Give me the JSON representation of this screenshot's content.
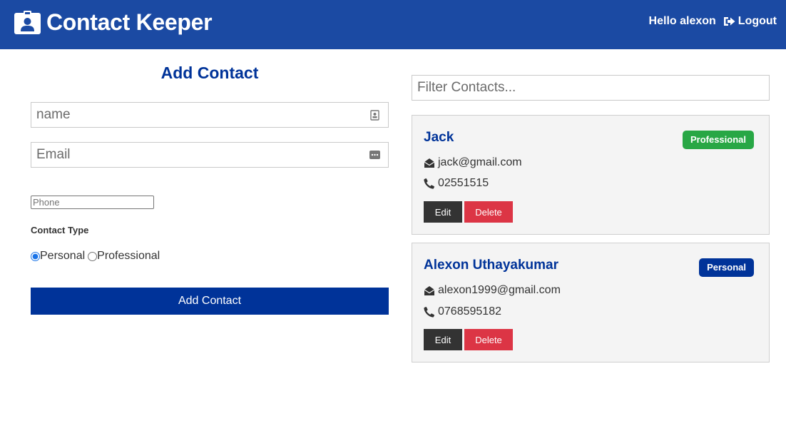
{
  "navbar": {
    "brand_title": "Contact Keeper",
    "greeting": "Hello alexon",
    "logout_label": "Logout",
    "bg_color": "#1b4aa3"
  },
  "form": {
    "title": "Add Contact",
    "name_placeholder": "name",
    "email_placeholder": "Email",
    "phone_placeholder": "Phone",
    "contact_type_label": "Contact Type",
    "type_options": [
      "Personal",
      "Professional"
    ],
    "selected_type": "Personal",
    "submit_label": "Add Contact",
    "accent_color": "#003399"
  },
  "filter": {
    "placeholder": "Filter Contacts..."
  },
  "contacts": [
    {
      "name": "Jack",
      "type": "Professional",
      "email": "jack@gmail.com",
      "phone": "02551515",
      "edit_label": "Edit",
      "delete_label": "Delete"
    },
    {
      "name": "Alexon Uthayakumar",
      "type": "Personal",
      "email": "alexon1999@gmail.com",
      "phone": "0768595182",
      "edit_label": "Edit",
      "delete_label": "Delete"
    }
  ],
  "icons": {
    "brand": "id-badge-icon",
    "logout": "sign-out-icon",
    "name_field": "contact-card-icon",
    "email_field": "password-dots-icon",
    "email": "envelope-open-icon",
    "phone": "phone-icon"
  }
}
